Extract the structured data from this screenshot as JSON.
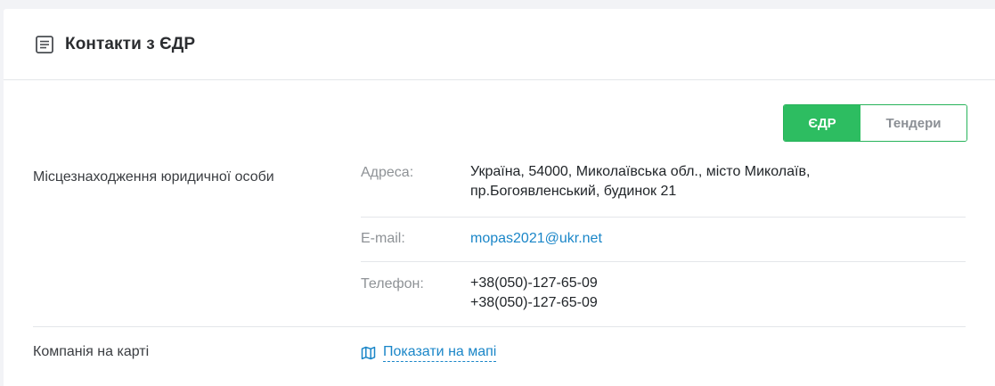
{
  "header": {
    "title": "Контакти з ЄДР",
    "icon": "document-list-icon"
  },
  "source_toggle": {
    "options": [
      "ЄДР",
      "Тендери"
    ],
    "selected": "ЄДР",
    "accent": "#2dbd61"
  },
  "location": {
    "label": "Місцезнаходження юридичної особи",
    "address_label": "Адреса:",
    "address_line1": "Україна, 54000, Миколаївська обл., місто Миколаїв,",
    "address_line2": "пр.Богоявленський, будинок 21",
    "email_label": "E-mail:",
    "email": "mopas2021@ukr.net",
    "phone_label": "Телефон:",
    "phones": [
      "+38(050)-127-65-09",
      "+38(050)-127-65-09"
    ]
  },
  "map": {
    "label": "Компанія на карті",
    "link_text": "Показати на мапі",
    "icon": "map-icon"
  }
}
